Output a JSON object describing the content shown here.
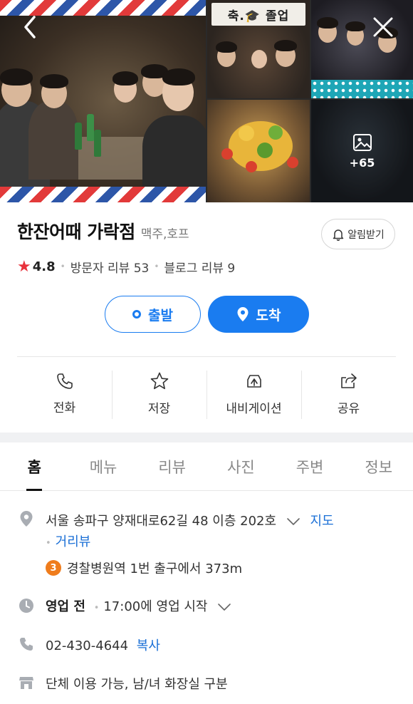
{
  "photos": {
    "banner_text": "축.🎓 졸업",
    "more_count": "+65"
  },
  "place": {
    "name": "한잔어때 가락점",
    "category": "맥주,호프",
    "notify_label": "알림받기",
    "rating": "4.8",
    "visitor_reviews": "방문자 리뷰 53",
    "blog_reviews": "블로그 리뷰 9"
  },
  "route": {
    "start_label": "출발",
    "arrive_label": "도착"
  },
  "actions": [
    {
      "label": "전화",
      "icon": "phone-icon"
    },
    {
      "label": "저장",
      "icon": "star-icon"
    },
    {
      "label": "내비게이션",
      "icon": "navigation-icon"
    },
    {
      "label": "공유",
      "icon": "share-icon"
    }
  ],
  "tabs": [
    "홈",
    "메뉴",
    "리뷰",
    "사진",
    "주변",
    "정보"
  ],
  "info": {
    "address": "서울 송파구 양재대로62길 48 이층 202호",
    "map_link": "지도",
    "street_view_link": "거리뷰",
    "subway_line": "3",
    "subway_text": "경찰병원역 1번 출구에서 373m",
    "hours_status": "영업 전",
    "hours_text": "17:00에 영업 시작",
    "phone": "02-430-4644",
    "copy_label": "복사",
    "facilities": "단체 이용 가능, 남/녀 화장실 구분"
  },
  "colors": {
    "accent": "#1a7cf0",
    "star": "#e8323c",
    "subway_line3": "#ef7c1c"
  }
}
